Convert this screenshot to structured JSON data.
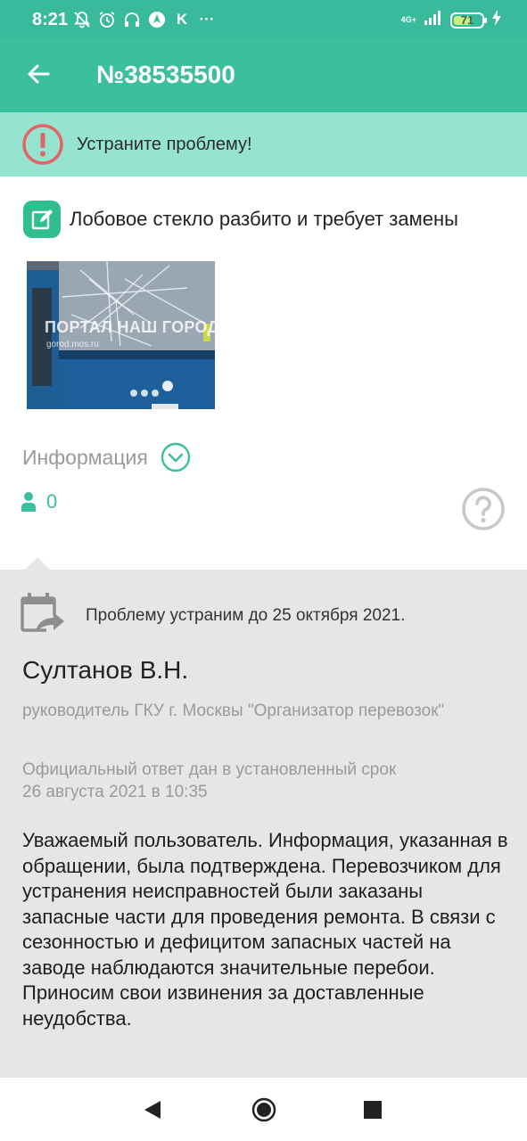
{
  "status_bar": {
    "time": "8:21",
    "icons": [
      "bell-off-icon",
      "alarm-icon",
      "headphones-icon",
      "navigation-icon",
      "k-icon",
      "more-icon"
    ],
    "k_label": "K",
    "more_label": "···",
    "network": "4G+",
    "battery": "71",
    "battery_level": 0.71
  },
  "app_bar": {
    "title": "№38535500"
  },
  "alert": {
    "text": "Устраните проблему!"
  },
  "issue": {
    "text": "Лобовое стекло разбито и требует замены",
    "photo_watermark": "ПОРТАЛ НАШ ГОРОД",
    "photo_watermark_url": "gorod.mos.ru"
  },
  "info": {
    "label": "Информация"
  },
  "likes": {
    "count": "0"
  },
  "response": {
    "deadline": "Проблему устраним до 25 октября 2021.",
    "name": "Султанов В.Н.",
    "position": "руководитель ГКУ г. Москвы \"Организатор перевозок\"",
    "official_note": "Официальный ответ дан в установленный срок",
    "date": "26 августа 2021 в 10:35",
    "body": "Уважаемый пользователь. Информация, указанная в обращении, была подтверждена. Перевозчиком для устранения неисправностей были заказаны запасные части для проведения ремонта. В связи с сезонностью и дефицитом запасных частей на заводе наблюдаются значительные перебои. Приносим свои извинения за доставленные неудобства."
  },
  "colors": {
    "brand": "#3cbf9e",
    "alert_bg": "#96e4cf",
    "alert_icon": "#e06666",
    "response_bg": "#e6e6e6"
  }
}
